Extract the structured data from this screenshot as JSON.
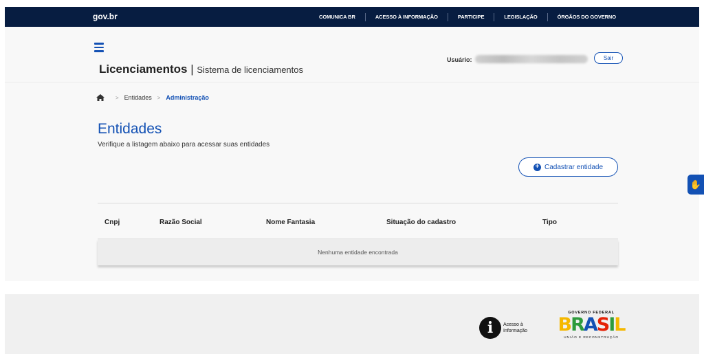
{
  "gov": {
    "logo": "gov.br",
    "links": [
      "COMUNICA BR",
      "ACESSO À INFORMAÇÃO",
      "PARTICIPE",
      "LEGISLAÇÃO",
      "ÓRGÃOS DO GOVERNO"
    ]
  },
  "header": {
    "title_main": "Licenciamentos",
    "title_sep": " | ",
    "title_sub": "Sistema de licenciamentos",
    "user_label": "Usuário:",
    "logout_label": "Sair"
  },
  "breadcrumb": {
    "items": [
      "Entidades",
      "Administração"
    ],
    "separator": ">"
  },
  "main": {
    "title": "Entidades",
    "description": "Verifique a listagem abaixo para acessar suas entidades",
    "add_button": "Cadastrar entidade"
  },
  "table": {
    "columns": [
      "Cnpj",
      "Razão Social",
      "Nome Fantasia",
      "Situação do cadastro",
      "Tipo"
    ],
    "empty_message": "Nenhuma entidade encontrada"
  },
  "footer": {
    "access_info_icon": "i",
    "access_info_line1": "Acesso à",
    "access_info_line2": "Informação",
    "brasil_top": "GOVERNO FEDERAL",
    "brasil_word": [
      "B",
      "R",
      "A",
      "S",
      "I",
      "L"
    ],
    "brasil_bottom": "UNIÃO E RECONSTRUÇÃO"
  },
  "icons": {
    "menu": "hamburger-icon",
    "home": "home-icon",
    "add": "plus-circle-icon",
    "accessibility": "vlibras-hands-icon"
  },
  "colors": {
    "gov_bar": "#071d41",
    "primary": "#1351b4"
  }
}
